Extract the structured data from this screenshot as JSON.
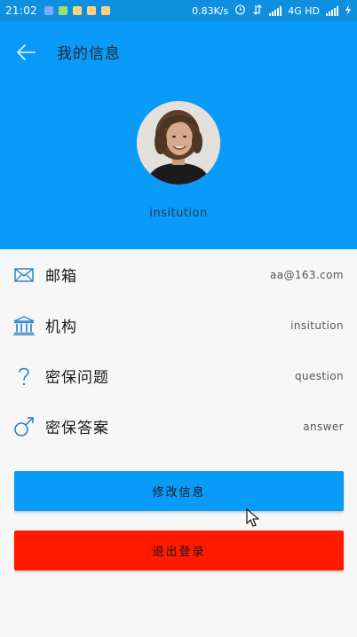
{
  "status_bar": {
    "time": "21:02",
    "speed": "0.83K/s",
    "network": "4G HD",
    "notification_colors": [
      "#7ea9ff",
      "#9be06a",
      "#ffd27a",
      "#ffcf80",
      "#ffcf80"
    ]
  },
  "header": {
    "title": "我的信息",
    "username": "insitution",
    "background_color": "#0a9af8"
  },
  "info_rows": [
    {
      "icon": "mail-icon",
      "label": "邮箱",
      "value": "aa@163.com"
    },
    {
      "icon": "institution-icon",
      "label": "机构",
      "value": "insitution"
    },
    {
      "icon": "question-icon",
      "label": "密保问题",
      "value": "question"
    },
    {
      "icon": "answer-icon",
      "label": "密保答案",
      "value": "answer"
    }
  ],
  "buttons": {
    "edit_label": "修改信息",
    "edit_color": "#0a9af8",
    "logout_label": "退出登录",
    "logout_color": "#ff1a00"
  }
}
